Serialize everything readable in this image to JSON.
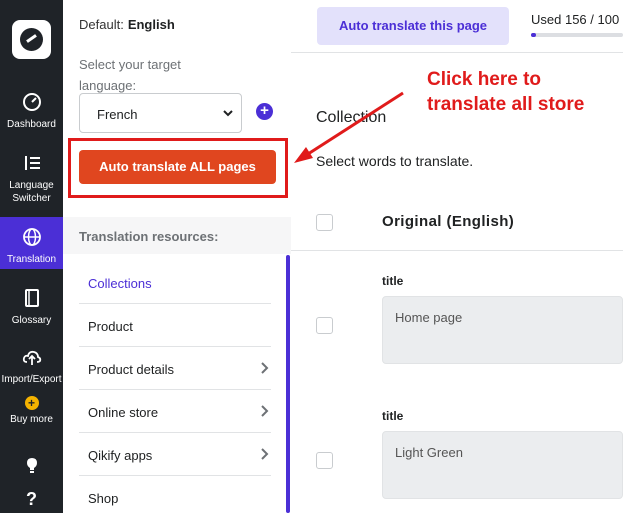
{
  "nav": {
    "items": [
      {
        "label": "Dashboard",
        "icon": "gauge-icon"
      },
      {
        "label": "Language Switcher",
        "icon": "list-order-icon"
      },
      {
        "label": "Translation",
        "icon": "globe-icon",
        "active": true
      },
      {
        "label": "Glossary",
        "icon": "book-icon"
      },
      {
        "label": "Import/Export",
        "icon": "cloud-upload-icon"
      },
      {
        "label": "Buy more",
        "icon": "plus-coin-icon"
      }
    ]
  },
  "panel": {
    "default_label": "Default:",
    "default_language": "English",
    "target_label": "Select your target language:",
    "target_value": "French",
    "auto_all_button": "Auto translate ALL pages",
    "resources_heading": "Translation resources:",
    "resources": [
      {
        "label": "Collections",
        "active": true,
        "has_arrow": false
      },
      {
        "label": "Product",
        "has_arrow": false
      },
      {
        "label": "Product details",
        "has_arrow": true
      },
      {
        "label": "Online store",
        "has_arrow": true
      },
      {
        "label": "Qikify apps",
        "has_arrow": true
      },
      {
        "label": "Shop",
        "has_arrow": false
      }
    ]
  },
  "main": {
    "auto_page_button": "Auto translate this page",
    "usage_text": "Used 156 / 100",
    "usage_fraction": 0.05,
    "collection_title": "Collection",
    "instruction": "Select words to translate.",
    "column_header": "Original (English)",
    "fields": [
      {
        "label": "title",
        "value": "Home page"
      },
      {
        "label": "title",
        "value": "Light Green"
      }
    ]
  },
  "annotation": {
    "callout_line1": "Click here to",
    "callout_line2": "translate all store",
    "color": "#e01b1b"
  },
  "colors": {
    "accent": "#4b2fd6",
    "orange_button": "#e0461f",
    "rail": "#1f2328"
  }
}
